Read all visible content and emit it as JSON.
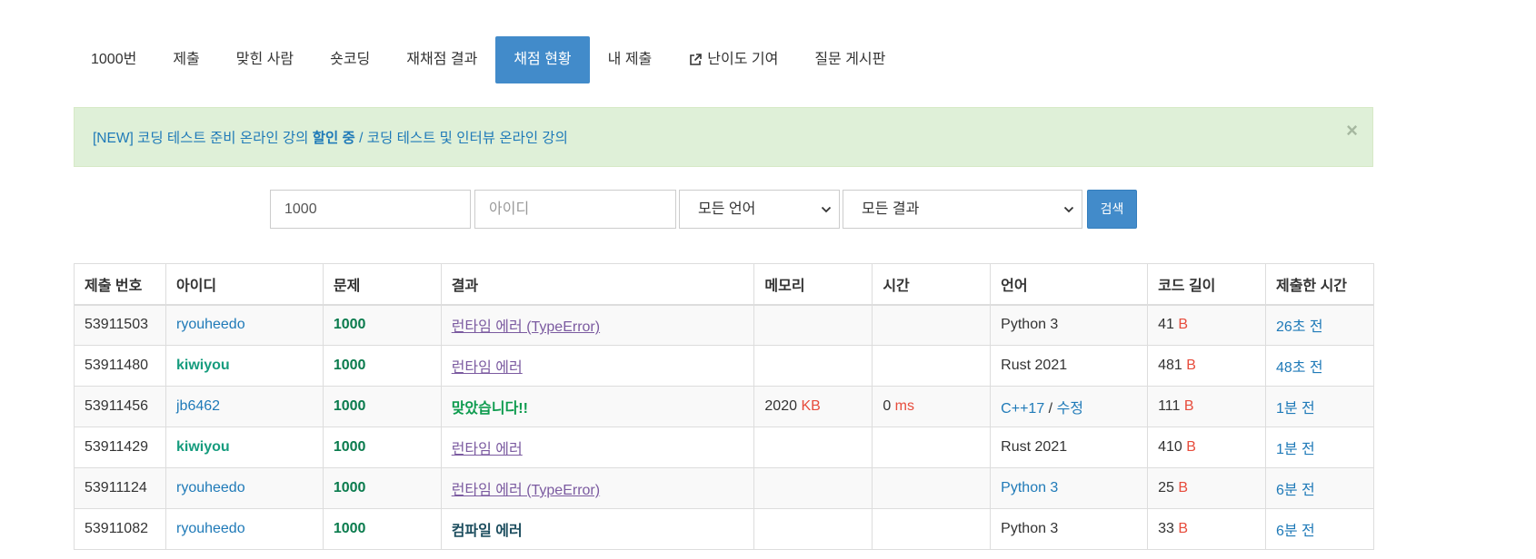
{
  "tabs": [
    {
      "label": "1000번",
      "active": false
    },
    {
      "label": "제출",
      "active": false
    },
    {
      "label": "맞힌 사람",
      "active": false
    },
    {
      "label": "숏코딩",
      "active": false
    },
    {
      "label": "재채점 결과",
      "active": false
    },
    {
      "label": "채점 현황",
      "active": true
    },
    {
      "label": "내 제출",
      "active": false
    },
    {
      "label": "난이도 기여",
      "active": false,
      "icon": "external-link-icon"
    },
    {
      "label": "질문 게시판",
      "active": false
    }
  ],
  "alert": {
    "prefix": "[NEW] 코딩 테스트 준비 온라인 강의 ",
    "bold": "할인 중",
    "suffix": " / 코딩 테스트 및 인터뷰 온라인 강의",
    "close": "×"
  },
  "search": {
    "problem_value": "1000",
    "user_placeholder": "아이디",
    "language_selected": "모든 언어",
    "result_selected": "모든 결과",
    "button_label": "검색"
  },
  "table": {
    "headers": [
      "제출 번호",
      "아이디",
      "문제",
      "결과",
      "메모리",
      "시간",
      "언어",
      "코드 길이",
      "제출한 시간"
    ],
    "rows": [
      {
        "id": "53911503",
        "user": "ryouheedo",
        "user_bold": false,
        "problem": "1000",
        "result": "런타임 에러 (TypeError)",
        "result_type": "runtime",
        "memory": "",
        "memory_unit": "",
        "time": "",
        "time_unit": "",
        "language": "Python 3",
        "language_link": false,
        "edit": "",
        "code_length": "41",
        "code_unit": "B",
        "submitted": "26초 전"
      },
      {
        "id": "53911480",
        "user": "kiwiyou",
        "user_bold": true,
        "problem": "1000",
        "result": "런타임 에러",
        "result_type": "runtime",
        "memory": "",
        "memory_unit": "",
        "time": "",
        "time_unit": "",
        "language": "Rust 2021",
        "language_link": false,
        "edit": "",
        "code_length": "481",
        "code_unit": "B",
        "submitted": "48초 전"
      },
      {
        "id": "53911456",
        "user": "jb6462",
        "user_bold": false,
        "problem": "1000",
        "result": "맞았습니다!!",
        "result_type": "accepted",
        "memory": "2020",
        "memory_unit": "KB",
        "time": "0",
        "time_unit": "ms",
        "language": "C++17",
        "language_link": true,
        "edit": "수정",
        "code_length": "111",
        "code_unit": "B",
        "submitted": "1분 전"
      },
      {
        "id": "53911429",
        "user": "kiwiyou",
        "user_bold": true,
        "problem": "1000",
        "result": "런타임 에러",
        "result_type": "runtime",
        "memory": "",
        "memory_unit": "",
        "time": "",
        "time_unit": "",
        "language": "Rust 2021",
        "language_link": false,
        "edit": "",
        "code_length": "410",
        "code_unit": "B",
        "submitted": "1분 전"
      },
      {
        "id": "53911124",
        "user": "ryouheedo",
        "user_bold": false,
        "problem": "1000",
        "result": "런타임 에러 (TypeError)",
        "result_type": "runtime",
        "memory": "",
        "memory_unit": "",
        "time": "",
        "time_unit": "",
        "language": "Python 3",
        "language_link": true,
        "edit": "",
        "code_length": "25",
        "code_unit": "B",
        "submitted": "6분 전"
      },
      {
        "id": "53911082",
        "user": "ryouheedo",
        "user_bold": false,
        "problem": "1000",
        "result": "컴파일 에러",
        "result_type": "compile",
        "memory": "",
        "memory_unit": "",
        "time": "",
        "time_unit": "",
        "language": "Python 3",
        "language_link": false,
        "edit": "",
        "code_length": "33",
        "code_unit": "B",
        "submitted": "6분 전"
      }
    ]
  },
  "colors": {
    "accent": "#428bca",
    "link": "#1f7ab8",
    "accepted": "#0d9b4e",
    "unit": "#e74c3c",
    "alert_bg": "#dff0d8"
  }
}
